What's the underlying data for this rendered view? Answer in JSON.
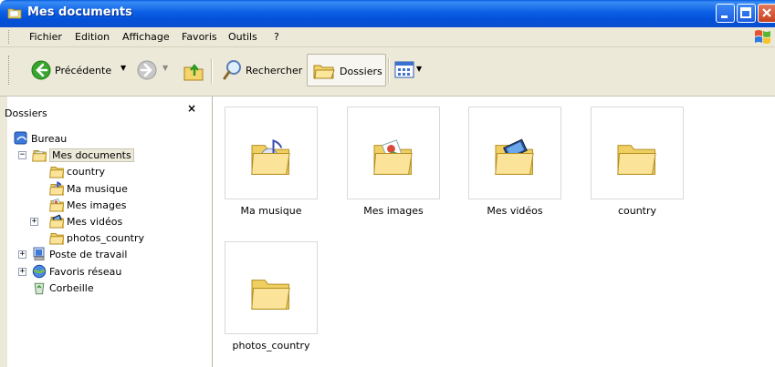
{
  "window": {
    "title": "Mes documents",
    "icon": "folder-documents-icon"
  },
  "menu": [
    "Fichier",
    "Edition",
    "Affichage",
    "Favoris",
    "Outils",
    "?"
  ],
  "toolbar": {
    "back_label": "Précédente",
    "search_label": "Rechercher",
    "folders_label": "Dossiers"
  },
  "folders_pane": {
    "title": "Dossiers",
    "close": "×",
    "tree": [
      {
        "label": "Bureau",
        "icon": "desktop-icon",
        "level": 0,
        "expander": ""
      },
      {
        "label": "Mes documents",
        "icon": "my-documents-icon",
        "level": 1,
        "expander": "−",
        "selected": true
      },
      {
        "label": "country",
        "icon": "folder-icon",
        "level": 2,
        "expander": ""
      },
      {
        "label": "Ma musique",
        "icon": "music-folder-icon",
        "level": 2,
        "expander": ""
      },
      {
        "label": "Mes images",
        "icon": "pictures-folder-icon",
        "level": 2,
        "expander": ""
      },
      {
        "label": "Mes vidéos",
        "icon": "videos-folder-icon",
        "level": 2,
        "expander": "+"
      },
      {
        "label": "photos_country",
        "icon": "folder-icon",
        "level": 2,
        "expander": ""
      },
      {
        "label": "Poste de travail",
        "icon": "computer-icon",
        "level": 1,
        "expander": "+"
      },
      {
        "label": "Favoris réseau",
        "icon": "network-icon",
        "level": 1,
        "expander": "+"
      },
      {
        "label": "Corbeille",
        "icon": "recycle-bin-icon",
        "level": 1,
        "expander": ""
      }
    ]
  },
  "items": [
    {
      "label": "Ma musique",
      "icon": "music-folder-icon"
    },
    {
      "label": "Mes images",
      "icon": "pictures-folder-icon"
    },
    {
      "label": "Mes vidéos",
      "icon": "videos-folder-icon"
    },
    {
      "label": "country",
      "icon": "folder-icon"
    },
    {
      "label": "photos_country",
      "icon": "folder-icon"
    }
  ],
  "colors": {
    "titlebar": "#0b5fe5",
    "chrome": "#ece9d8",
    "folder": "#f5dc7a"
  }
}
